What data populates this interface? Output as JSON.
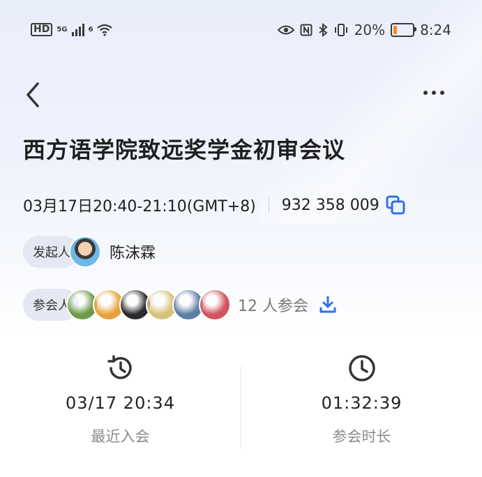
{
  "status_bar": {
    "left": {
      "hd": "HD",
      "net": "5G",
      "wifi_gen": "6"
    },
    "battery_percent": "20%",
    "battery_level": 0.2,
    "time": "8:24"
  },
  "meeting": {
    "title": "西方语学院致远奖学金初审会议",
    "datetime": "03月17日20:40-21:10(GMT+8)",
    "meeting_id": "932 358 009"
  },
  "host": {
    "chip_label": "发起人",
    "name": "陈沫霖"
  },
  "participants": {
    "chip_label": "参会人",
    "count_text": "12 人参会",
    "avatars": [
      {
        "desc": "outdoor-green",
        "color": "#6c9a4a"
      },
      {
        "desc": "star",
        "color": "#e9a13b"
      },
      {
        "desc": "dark-light",
        "color": "#2b2a2e"
      },
      {
        "desc": "yellow-pattern",
        "color": "#d6c27a"
      },
      {
        "desc": "sea",
        "color": "#5d7fa3"
      },
      {
        "desc": "red-flower",
        "color": "#d2545f"
      }
    ]
  },
  "stats": {
    "last_join": {
      "value": "03/17 20:34",
      "label": "最近入会"
    },
    "duration": {
      "value": "01:32:39",
      "label": "参会时长"
    }
  },
  "colors": {
    "accent": "#2f6ee6",
    "icon_dark": "#333333"
  }
}
